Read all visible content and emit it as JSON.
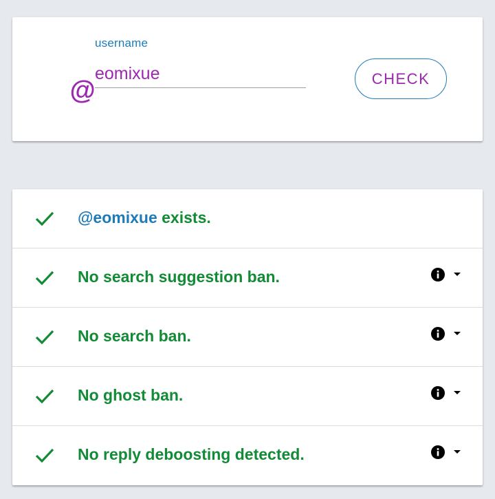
{
  "search": {
    "label": "username",
    "value": "eomixue",
    "button_label": "CHECK",
    "icon": "at-icon"
  },
  "results": [
    {
      "handle": "@eomixue",
      "text": " exists.",
      "has_details": false,
      "status": "pass"
    },
    {
      "handle": "",
      "text": "No search suggestion ban.",
      "has_details": true,
      "status": "pass"
    },
    {
      "handle": "",
      "text": "No search ban.",
      "has_details": true,
      "status": "pass"
    },
    {
      "handle": "",
      "text": "No ghost ban.",
      "has_details": true,
      "status": "pass"
    },
    {
      "handle": "",
      "text": "No reply deboosting detected.",
      "has_details": true,
      "status": "pass"
    }
  ],
  "colors": {
    "accent": "#9c27b0",
    "link": "#1e7bb8",
    "success": "#138a36",
    "background": "#e6eaee"
  }
}
